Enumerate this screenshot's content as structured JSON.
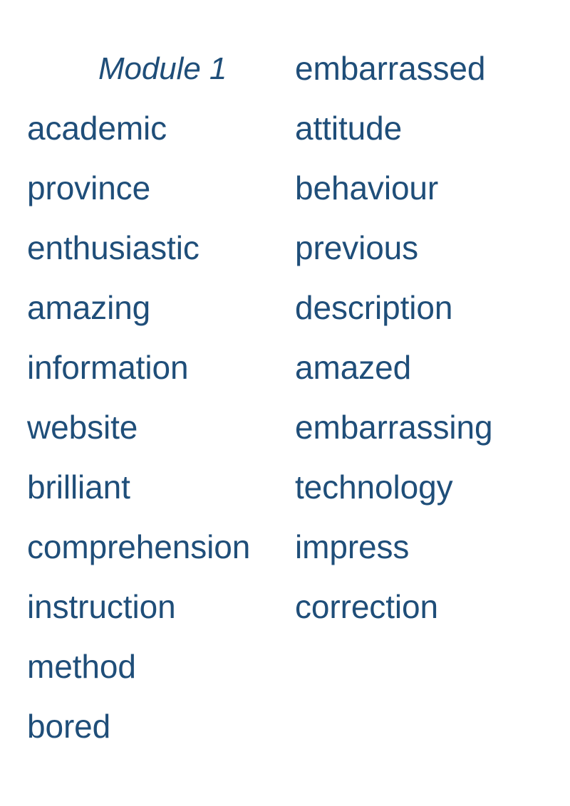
{
  "document": {
    "title": "Module 1",
    "text_color": "#1f4e79",
    "background_color": "#ffffff"
  },
  "columns": {
    "left": {
      "header": "Module 1",
      "words": [
        "academic",
        "province",
        "enthusiastic",
        "amazing",
        "information",
        "website",
        "brilliant",
        "comprehension",
        "instruction",
        "method",
        "bored"
      ]
    },
    "right": {
      "header": "embarrassed",
      "words": [
        "attitude",
        "behaviour",
        "previous",
        "description",
        "amazed",
        "embarrassing",
        "technology",
        "impress",
        "correction"
      ]
    }
  }
}
